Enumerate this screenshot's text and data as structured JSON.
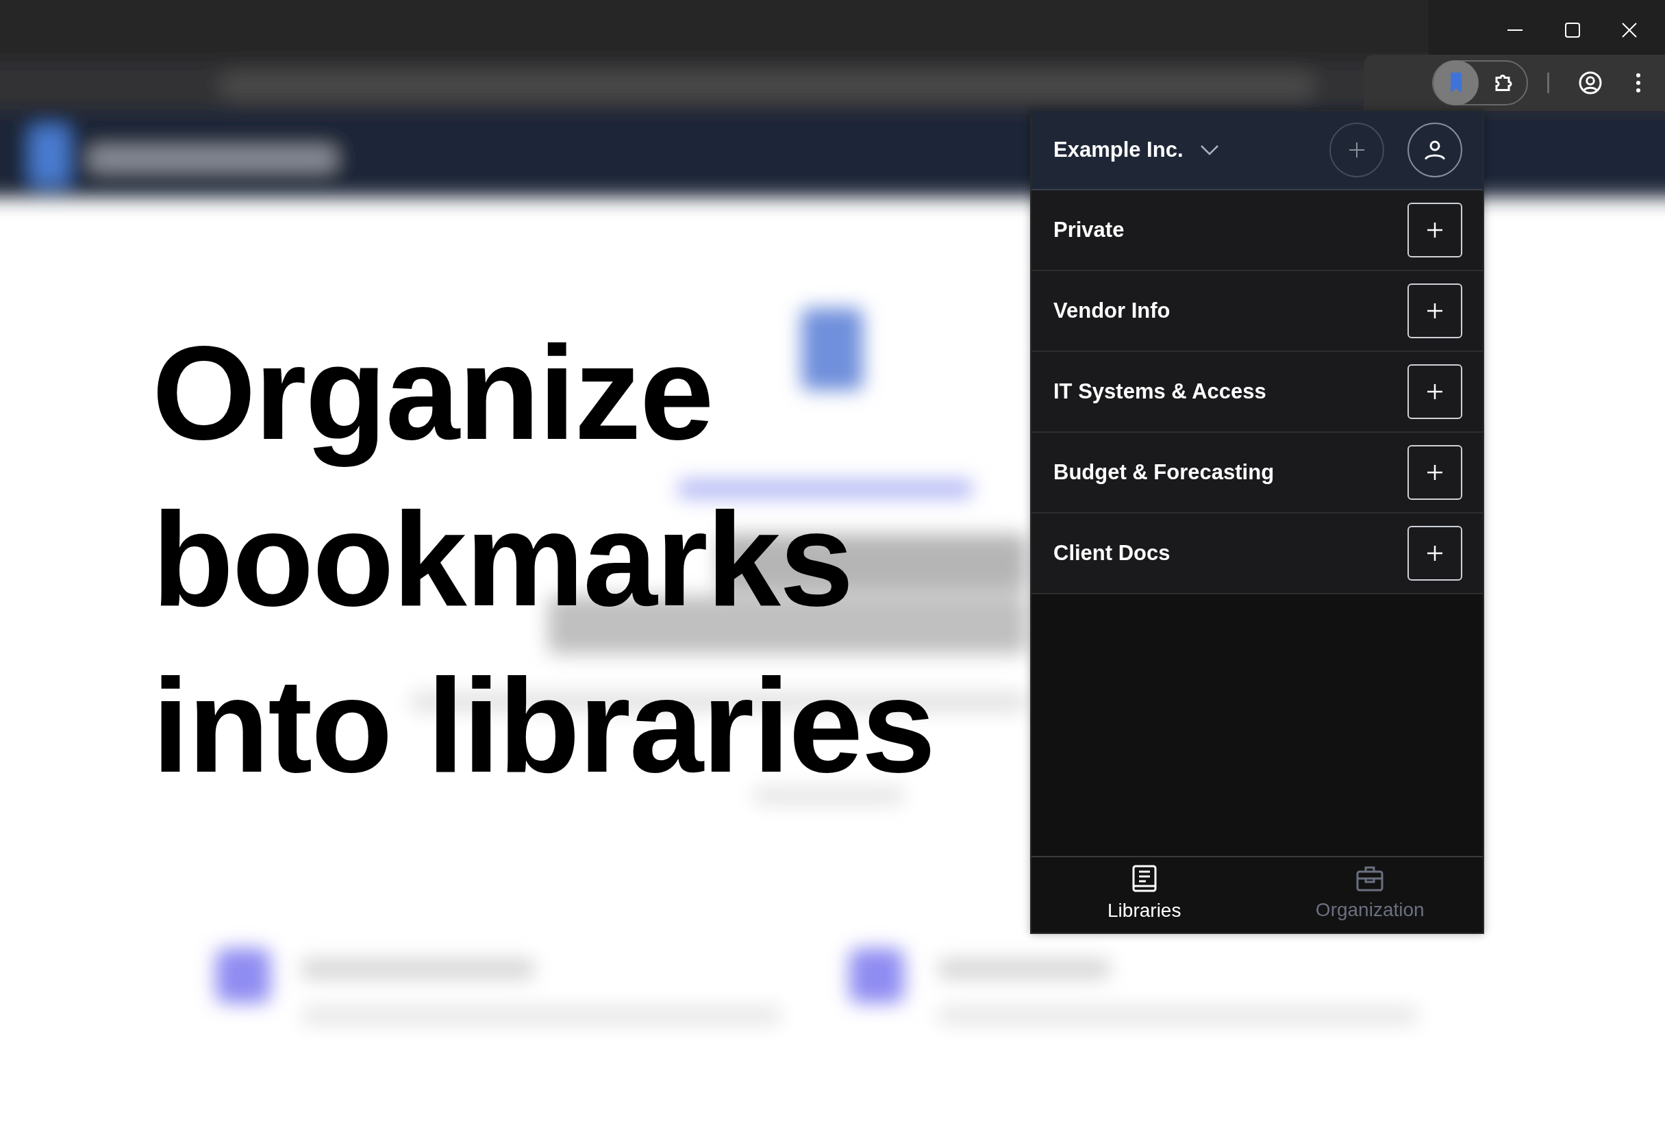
{
  "headline": "Organize bookmarks into libraries",
  "popup": {
    "organization": "Example Inc.",
    "libraries": [
      {
        "name": "Private"
      },
      {
        "name": "Vendor Info"
      },
      {
        "name": "IT Systems & Access"
      },
      {
        "name": "Budget & Forecasting"
      },
      {
        "name": "Client Docs"
      }
    ],
    "nav": [
      {
        "label": "Libraries",
        "kind": "book",
        "selected": true
      },
      {
        "label": "Organization",
        "kind": "briefcase",
        "selected": false
      }
    ]
  }
}
